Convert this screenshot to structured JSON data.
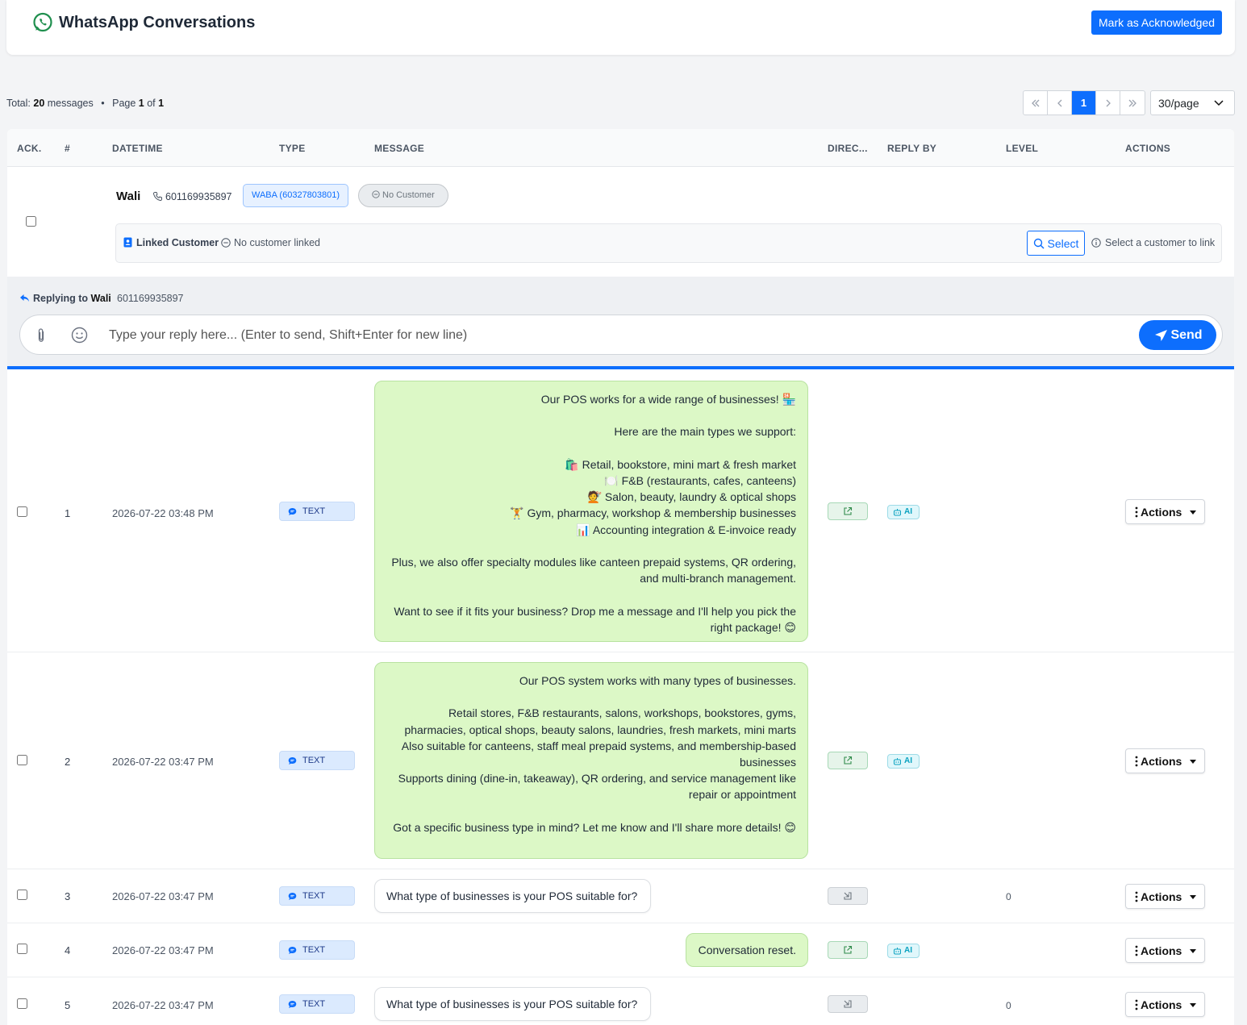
{
  "header": {
    "title": "WhatsApp Conversations",
    "ack_button": "Mark as Acknowledged"
  },
  "summary": {
    "total_label": "Total:",
    "total_count": "20",
    "total_unit": "messages",
    "page_label": "Page",
    "page_current": "1",
    "page_of": "of",
    "page_total": "1"
  },
  "pagination": {
    "current_page": "1",
    "per_page": "30/page"
  },
  "columns": [
    "ACK.",
    "#",
    "DATETIME",
    "TYPE",
    "MESSAGE",
    "DIREC...",
    "REPLY BY",
    "LEVEL",
    "ACTIONS"
  ],
  "contact": {
    "name": "Wali",
    "phone": "601169935897",
    "waba": "WABA (60327803801)",
    "customer_status": "No Customer",
    "linked_label": "Linked Customer",
    "linked_value": "No customer linked",
    "select_button": "Select",
    "select_hint": "Select a customer to link"
  },
  "reply": {
    "replying_to_label": "Replying to",
    "name": "Wali",
    "phone": "601169935897",
    "placeholder": "Type your reply here... (Enter to send, Shift+Enter for new line)",
    "send_label": "Send"
  },
  "messages": [
    {
      "num": "1",
      "datetime": "2026-07-22 03:48 PM",
      "type": "TEXT",
      "direction": "outgoing",
      "reply_by": "AI",
      "level": "",
      "text": "Our POS works for a wide range of businesses! 🏪\n\nHere are the main types we support:\n\n🛍️ Retail, bookstore, mini mart & fresh market\n🍽️ F&B (restaurants, cafes, canteens)\n💇 Salon, beauty, laundry & optical shops\n🏋️ Gym, pharmacy, workshop & membership businesses\n📊 Accounting integration & E-invoice ready\n\nPlus, we also offer specialty modules like canteen prepaid systems, QR ordering, and multi-branch management.\n\nWant to see if it fits your business? Drop me a message and I'll help you pick the right package! 😊",
      "actions_label": "Actions"
    },
    {
      "num": "2",
      "datetime": "2026-07-22 03:47 PM",
      "type": "TEXT",
      "direction": "outgoing",
      "reply_by": "AI",
      "level": "",
      "text": "Our POS system works with many types of businesses.\n\nRetail stores, F&B restaurants, salons, workshops, bookstores, gyms, pharmacies, optical shops, beauty salons, laundries, fresh markets, mini marts\nAlso suitable for canteens, staff meal prepaid systems, and membership-based businesses\nSupports dining (dine-in, takeaway), QR ordering, and service management like repair or appointment\n\nGot a specific business type in mind? Let me know and I'll share more details! 😊",
      "actions_label": "Actions"
    },
    {
      "num": "3",
      "datetime": "2026-07-22 03:47 PM",
      "type": "TEXT",
      "direction": "incoming",
      "reply_by": "",
      "level": "0",
      "text": "What type of businesses is your POS suitable for?",
      "actions_label": "Actions"
    },
    {
      "num": "4",
      "datetime": "2026-07-22 03:47 PM",
      "type": "TEXT",
      "direction": "outgoing",
      "reply_by": "AI",
      "level": "",
      "text": "Conversation reset.",
      "actions_label": "Actions"
    },
    {
      "num": "5",
      "datetime": "2026-07-22 03:47 PM",
      "type": "TEXT",
      "direction": "incoming",
      "reply_by": "",
      "level": "0",
      "text": "What type of businesses is your POS suitable for?",
      "actions_label": "Actions"
    }
  ],
  "colors": {
    "primary": "#0d6efd",
    "outgoing_bubble": "#dcf8c6",
    "whatsapp_green": "#25a85a",
    "ai_badge": "#0aa2c0"
  }
}
